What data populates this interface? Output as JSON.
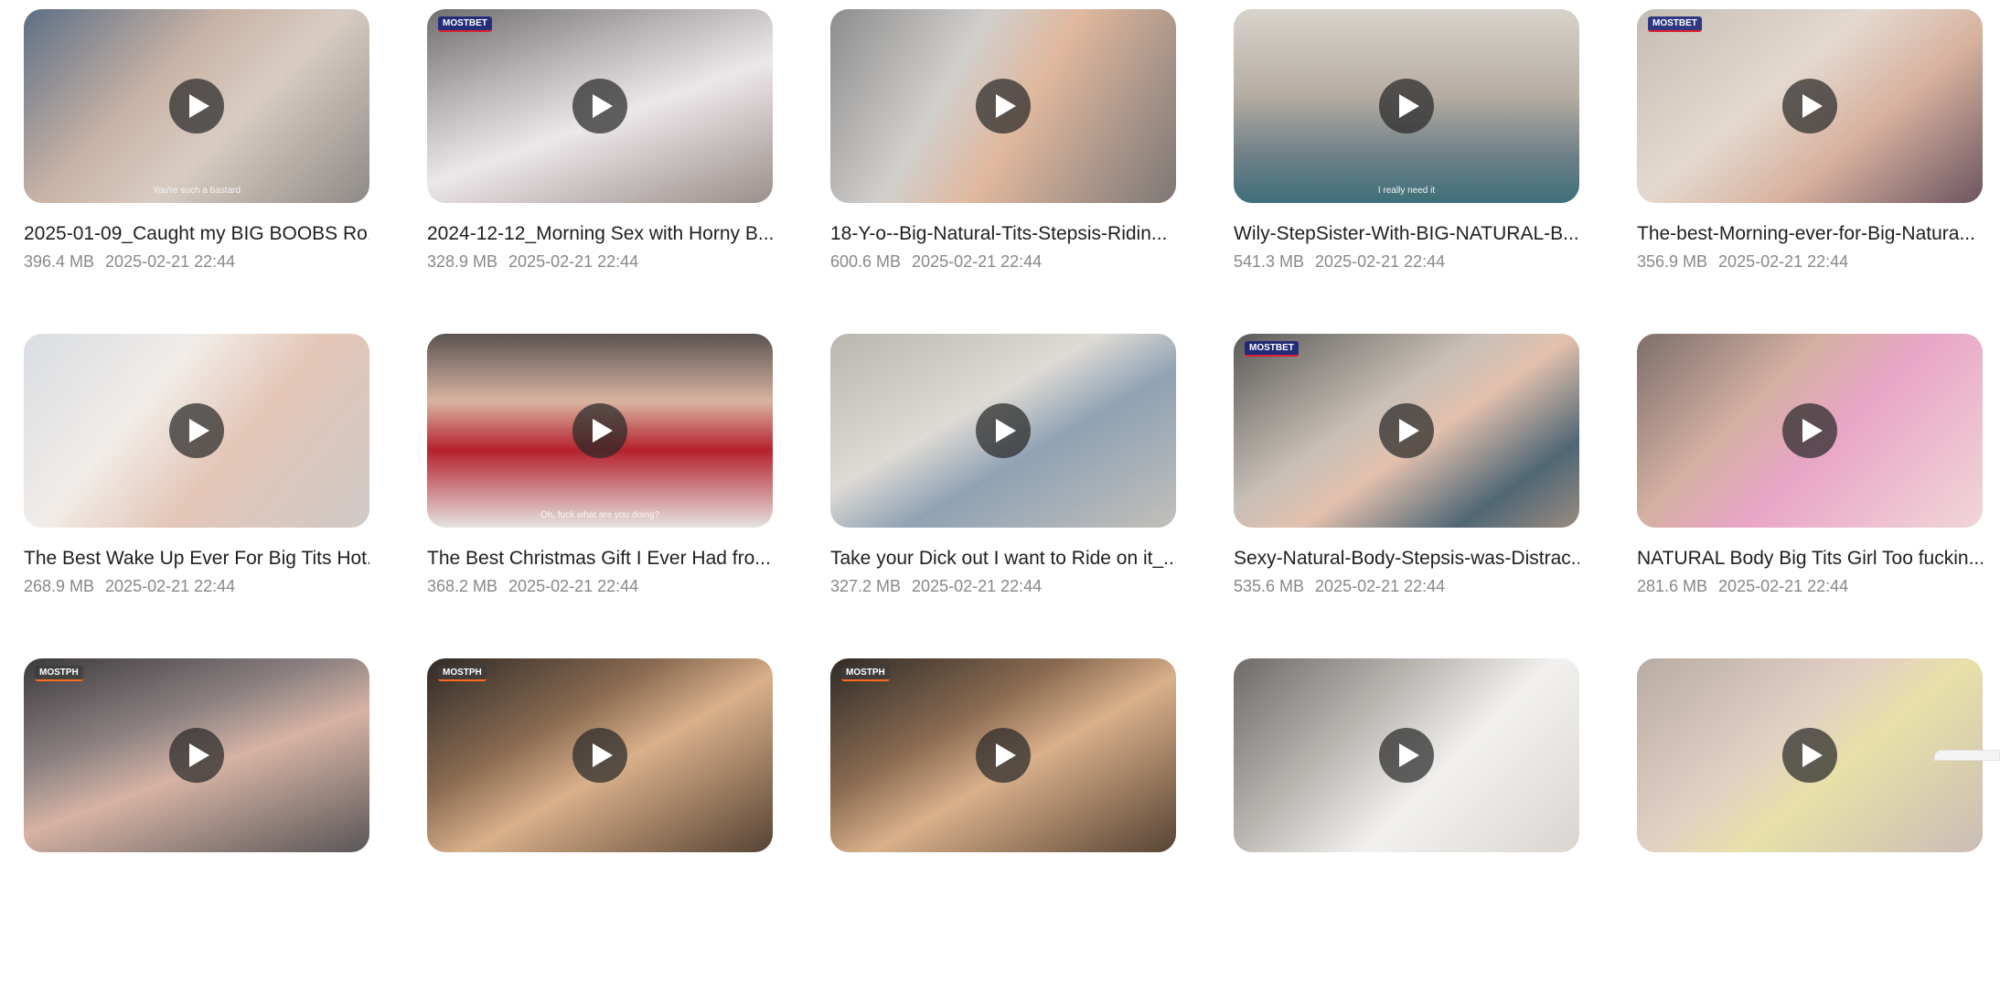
{
  "videos": [
    {
      "title": "2025-01-09_Caught my BIG BOOBS Ro...",
      "size": "396.4 MB",
      "date": "2025-02-21 22:44",
      "caption": "You're such a bastard",
      "badge": "",
      "bg": "linear-gradient(135deg,#5c6f85 0%,#c9b3a6 38%,#d8ccc2 60%,#8e8a86 100%)"
    },
    {
      "title": "2024-12-12_Morning Sex with Horny B...",
      "size": "328.9 MB",
      "date": "2025-02-21 22:44",
      "caption": "",
      "badge": "MOSTBET",
      "bg": "linear-gradient(160deg,#6e6e70 0%,#b7b2b3 30%,#ece7ea 55%,#9a8f8a 100%)"
    },
    {
      "title": "18-Y-o--Big-Natural-Tits-Stepsis-Ridin...",
      "size": "600.6 MB",
      "date": "2025-02-21 22:44",
      "caption": "",
      "badge": "",
      "bg": "linear-gradient(120deg,#8c8c8c 0%,#d1cfcd 35%,#e0b89e 55%,#7c7776 100%)"
    },
    {
      "title": "Wily-StepSister-With-BIG-NATURAL-B...",
      "size": "541.3 MB",
      "date": "2025-02-21 22:44",
      "caption": "I really need it",
      "badge": "",
      "bg": "linear-gradient(180deg,#d8d3cc 0%,#b5aca2 45%,#6f8087 75%,#3e6f7a 100%)"
    },
    {
      "title": "The-best-Morning-ever-for-Big-Natura...",
      "size": "356.9 MB",
      "date": "2025-02-21 22:44",
      "caption": "",
      "badge": "MOSTBET",
      "bg": "linear-gradient(140deg,#c4bcb3 0%,#e4d9cf 40%,#d7b19e 65%,#6c5560 100%)"
    },
    {
      "title": "The Best Wake Up Ever For Big Tits Hot...",
      "size": "268.9 MB",
      "date": "2025-02-21 22:44",
      "caption": "",
      "badge": "",
      "bg": "linear-gradient(130deg,#d9dde2 0%,#f1ece8 35%,#e4c6b7 60%,#cfc9c6 100%)"
    },
    {
      "title": "The Best Christmas Gift I Ever Had fro...",
      "size": "368.2 MB",
      "date": "2025-02-21 22:44",
      "caption": "Oh, fuck what are you doing?",
      "badge": "",
      "bg": "linear-gradient(180deg,#5a5350 0%,#d9b3a1 35%,#b5212d 60%,#e6e3e1 100%)"
    },
    {
      "title": "Take your Dick out I want to Ride on it_...",
      "size": "327.2 MB",
      "date": "2025-02-21 22:44",
      "caption": "",
      "badge": "",
      "bg": "linear-gradient(150deg,#b9b6b0 0%,#dedad4 40%,#8fa2b4 60%,#c2bfba 100%)"
    },
    {
      "title": "Sexy-Natural-Body-Stepsis-was-Distrac...",
      "size": "535.6 MB",
      "date": "2025-02-21 22:44",
      "caption": "",
      "badge": "MOSTBET",
      "bg": "linear-gradient(145deg,#5b5a58 0%,#c8bfb6 40%,#e3c0ad 55%,#4f6775 80%,#9a8b80 100%)"
    },
    {
      "title": "NATURAL Body Big Tits Girl Too fuckin...",
      "size": "281.6 MB",
      "date": "2025-02-21 22:44",
      "caption": "",
      "badge": "",
      "bg": "linear-gradient(135deg,#7d6e6a 0%,#d4b0a2 35%,#e9a5c6 55%,#f0d6d8 100%)"
    },
    {
      "title": "",
      "size": "",
      "date": "",
      "caption": "",
      "badge": "MOSTPH",
      "bg": "linear-gradient(160deg,#3c3a3d 0%,#8c8182 35%,#d6b3a3 55%,#5a5658 100%)"
    },
    {
      "title": "",
      "size": "",
      "date": "",
      "caption": "",
      "badge": "MOSTPH",
      "bg": "linear-gradient(150deg,#2f2a26 0%,#8a6b52 35%,#d9b08a 55%,#574334 100%)"
    },
    {
      "title": "",
      "size": "",
      "date": "",
      "caption": "",
      "badge": "MOSTPH",
      "bg": "linear-gradient(150deg,#2f2a26 0%,#8a6b52 35%,#d9b08a 55%,#574334 100%)"
    },
    {
      "title": "",
      "size": "",
      "date": "",
      "caption": "",
      "badge": "",
      "bg": "linear-gradient(135deg,#6d6a68 0%,#bab6b2 35%,#f2f1ef 60%,#d9d5d1 100%)"
    },
    {
      "title": "",
      "size": "",
      "date": "",
      "caption": "",
      "badge": "",
      "bg": "linear-gradient(140deg,#b8aca3 0%,#e2cfc4 40%,#e8e0a8 58%,#c9bdb6 100%)"
    }
  ],
  "colors": {
    "title_text": "#1f1f1f",
    "meta_text": "#888888",
    "play_button_bg": "#282828"
  },
  "icons": {
    "play": "play-icon"
  }
}
